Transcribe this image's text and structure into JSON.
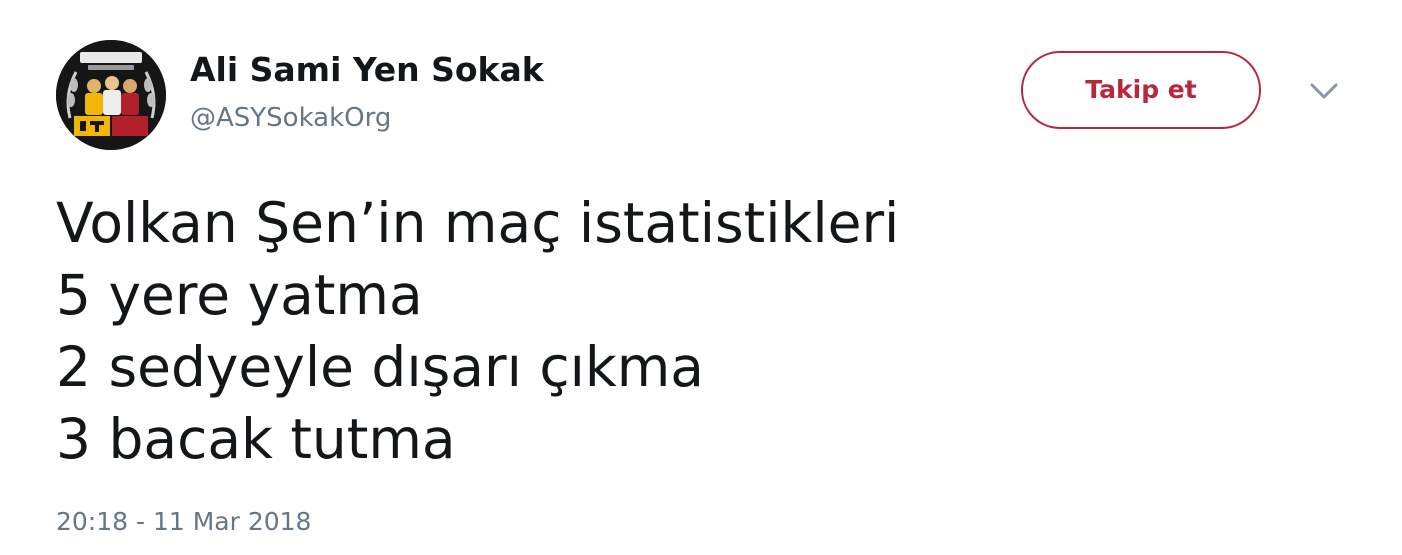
{
  "author": {
    "display_name": "Ali Sami Yen Sokak",
    "handle": "@ASYSokakOrg",
    "avatar_text": "ALİ SAMİ YEN SOKAK"
  },
  "actions": {
    "follow_label": "Takip et",
    "more_icon": "chevron-down-icon"
  },
  "tweet": {
    "lines": [
      "Volkan Şen’in maç istatistikleri",
      "5 yere yatma",
      "2 sedyeyle dışarı çıkma",
      "3 bacak tutma"
    ],
    "timestamp": "20:18 - 11 Mar 2018"
  },
  "colors": {
    "text": "#14171a",
    "secondary_text": "#657786",
    "follow_accent": "#b5283d",
    "background": "#ffffff"
  }
}
